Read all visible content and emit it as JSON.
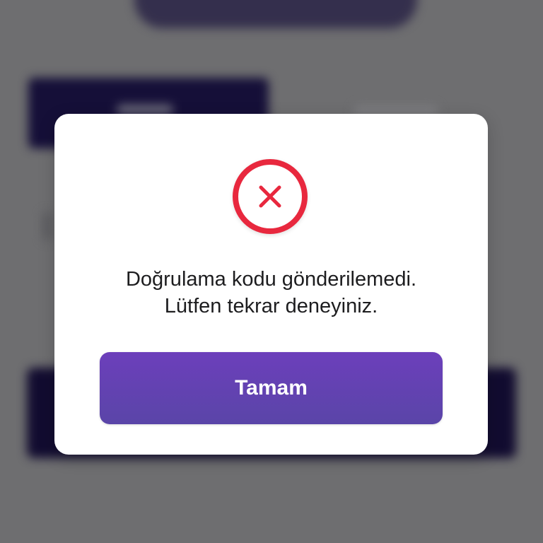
{
  "dialog": {
    "icon": "error-x-icon",
    "message_line1": "Doğrulama kodu gönderilemedi.",
    "message_line2": "Lütfen tekrar deneyiniz.",
    "ok_label": "Tamam"
  },
  "colors": {
    "error_red": "#e8283e",
    "button_purple": "#6a40b8",
    "overlay_gray": "#6e6e70",
    "background_navy": "#150f38"
  }
}
